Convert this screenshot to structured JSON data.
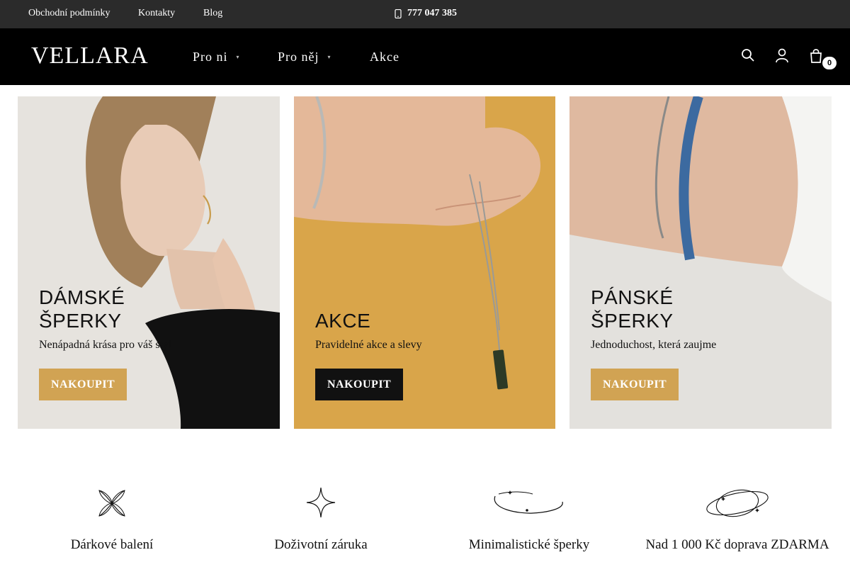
{
  "topbar": {
    "links": [
      "Obchodní podmínky",
      "Kontakty",
      "Blog"
    ],
    "phone": "777 047 385"
  },
  "header": {
    "logo": "VELLARA",
    "nav": [
      "Pro ni",
      "Pro něj",
      "Akce"
    ],
    "cart_count": "0",
    "icons": [
      "search-icon",
      "user-icon",
      "cart-icon"
    ]
  },
  "banners": [
    {
      "title_line1": "DÁMSKÉ",
      "title_line2": "ŠPERKY",
      "subtitle": "Nenápadná krása pro váš styl",
      "button": "NAKOUPIT",
      "button_color": "#d1a353"
    },
    {
      "title_line1": "",
      "title_line2": "AKCE",
      "subtitle": "Pravidelné akce a slevy",
      "button": "NAKOUPIT",
      "button_color": "#111111"
    },
    {
      "title_line1": "PÁNSKÉ",
      "title_line2": "ŠPERKY",
      "subtitle": "Jednoduchost, která zaujme",
      "button": "NAKOUPIT",
      "button_color": "#d1a353"
    }
  ],
  "features": [
    {
      "label": "Dárkové balení",
      "icon": "ribbon-icon"
    },
    {
      "label": "Doživotní záruka",
      "icon": "star-icon"
    },
    {
      "label": "Minimalistické šperky",
      "icon": "bracelet-icon"
    },
    {
      "label": "Nad 1 000 Kč doprava ZDARMA",
      "icon": "orbit-icon"
    }
  ],
  "colors": {
    "accent_gold": "#d1a353",
    "akce_background": "#d9a54a",
    "header_bg": "#000000",
    "topbar_bg": "#2b2b2b"
  }
}
